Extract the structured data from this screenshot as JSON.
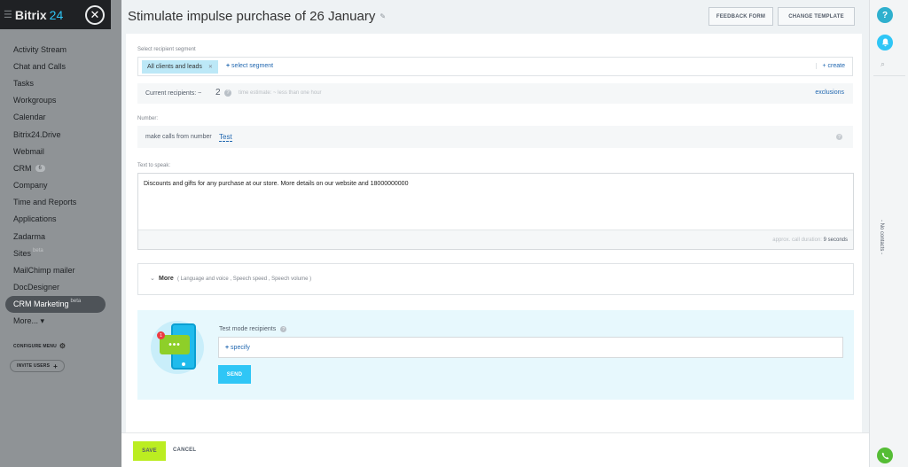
{
  "sidebar": {
    "logo": {
      "text": "Bitrix",
      "num": "24"
    },
    "items": [
      {
        "label": "Activity Stream"
      },
      {
        "label": "Chat and Calls"
      },
      {
        "label": "Tasks"
      },
      {
        "label": "Workgroups"
      },
      {
        "label": "Calendar"
      },
      {
        "label": "Bitrix24.Drive"
      },
      {
        "label": "Webmail"
      },
      {
        "label": "CRM",
        "counter": "6"
      },
      {
        "label": "Company"
      },
      {
        "label": "Time and Reports"
      },
      {
        "label": "Applications"
      },
      {
        "label": "Zadarma"
      },
      {
        "label": "Sites",
        "beta": "beta"
      },
      {
        "label": "MailChimp mailer"
      },
      {
        "label": "DocDesigner"
      },
      {
        "label": "CRM Marketing",
        "beta": "beta",
        "active": true
      },
      {
        "label": "More... ▾"
      }
    ],
    "configure_menu": "CONFIGURE MENU",
    "invite_users": "INVITE USERS"
  },
  "header": {
    "title": "Stimulate impulse purchase of 26 January",
    "feedback_form": "FEEDBACK FORM",
    "change_template": "CHANGE TEMPLATE"
  },
  "segment": {
    "label": "Select recipient segment",
    "selected_tag": "All clients and leads",
    "add_plus": "+",
    "add_text": "select segment",
    "create": "+ create"
  },
  "recipients": {
    "label": "Current recipients: ~",
    "count": "2",
    "estimate": "time estimate: ~ less than one hour",
    "exclusions": "exclusions"
  },
  "number": {
    "label": "Number:",
    "text": "make calls from number",
    "value": "Test"
  },
  "speak": {
    "label": "Text to speak:",
    "text": "Discounts and gifts for any purchase at our store. More details on our website and 18000000000",
    "duration_label": "approx. call duration:",
    "duration_value": "9 seconds"
  },
  "more": {
    "label": "More",
    "sub": "( Language and voice ,  Speech speed ,  Speech volume  )"
  },
  "test": {
    "label": "Test mode recipients",
    "badge": "1",
    "bubble": "•••",
    "specify_plus": "+",
    "specify": "specify",
    "send": "SEND"
  },
  "footer": {
    "save": "SAVE",
    "cancel": "CANCEL"
  },
  "right": {
    "help": "?",
    "no_contacts": "- No contacts -"
  },
  "colors": {
    "accent": "#2fc6f6",
    "save_green": "#bbed21",
    "link": "#2067b0",
    "dark": "#1f2124"
  }
}
